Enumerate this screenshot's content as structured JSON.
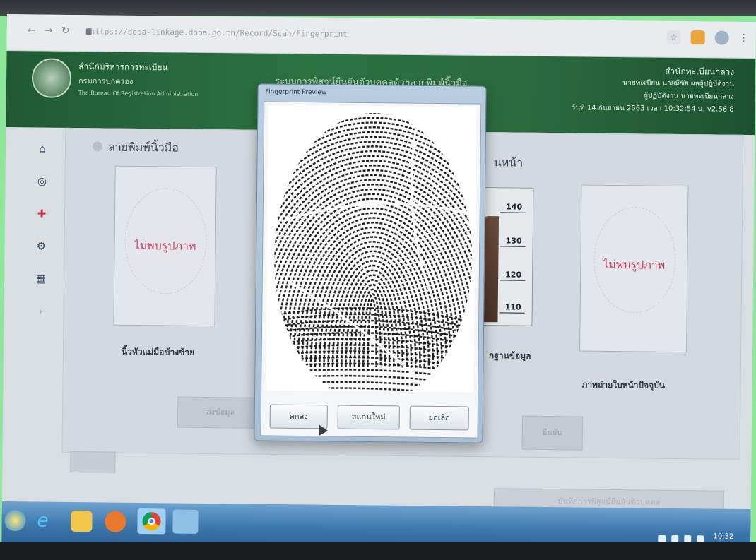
{
  "browser": {
    "url": "https://dopa-linkage.dopa.go.th/Record/Scan/Fingerprint",
    "back_icon": "back-arrow-icon",
    "forward_icon": "forward-arrow-icon",
    "reload_icon": "reload-icon"
  },
  "header": {
    "org_title": "สำนักบริหารการทะเบียน",
    "org_sub": "กรมการปกครอง",
    "org_en": "The Bureau Of Registration Administration",
    "center_title": "ระบบการพิสูจน์ยืนยันตัวบุคคลด้วยลายพิมพ์นิ้วมือ",
    "right_title": "สำนักทะเบียนกลาง",
    "right_user": "นายทะเบียน นายมีชัย ผลผู้ปฏิบัติงาน",
    "right_role": "ผู้ปฏิบัติงาน นายทะเบียนกลาง",
    "right_date": "วันที่ 14 กันยายน 2563 เวลา 10:32:54 น. v2.56.8"
  },
  "main": {
    "section_title": "ลายพิมพ์นิ้วมือ",
    "section_title_right": "นหน้า",
    "left_photo": {
      "placeholder": "ไม่พบรูปภาพ",
      "caption": "นิ้วหัวแม่มือข้างซ้าย"
    },
    "right_photo": {
      "placeholder": "ไม่พบรูปภาพ",
      "caption": "ภาพถ่ายใบหน้าปัจจุบัน"
    },
    "middle_caption": "กฐานข้อมูล",
    "height_marks": [
      "140",
      "130",
      "120",
      "110"
    ],
    "faded_button_left": "ส่งข้อมูล",
    "faded_button_right": "ยืนยัน",
    "lower_bar": "บันทึกการพิสูจน์ยืนยันตัวบุคคล"
  },
  "dialog": {
    "title": "Fingerprint Preview",
    "buttons": [
      "ตกลง",
      "สแกนใหม่",
      "ยกเลิก"
    ]
  },
  "taskbar": {
    "time": "10:32",
    "icons": [
      "start-orb-icon",
      "internet-explorer-icon",
      "file-explorer-icon",
      "media-player-icon",
      "chrome-icon",
      "app-window-icon"
    ]
  }
}
